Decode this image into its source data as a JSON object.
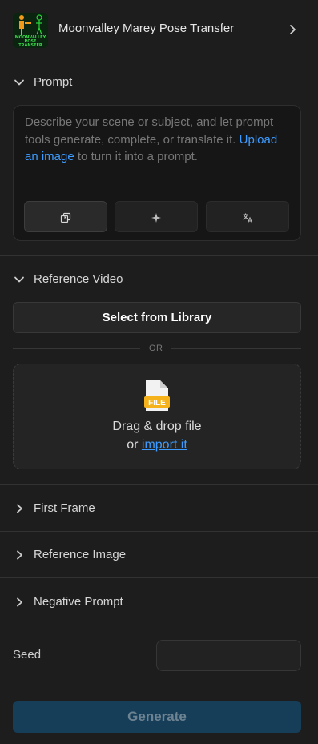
{
  "header": {
    "title": "Moonvalley Marey Pose Transfer",
    "thumb_text": [
      "MOONVALLEY",
      "POSE",
      "TRANSFER"
    ]
  },
  "prompt": {
    "section_label": "Prompt",
    "text_before": "Describe your scene or subject, and let prompt tools generate, complete, or translate it. ",
    "link_text": "Upload an image",
    "text_after": " to turn it into a prompt.",
    "tools": [
      {
        "icon": "copy-icon"
      },
      {
        "icon": "sparkle-icon"
      },
      {
        "icon": "translate-icon"
      }
    ]
  },
  "reference_video": {
    "section_label": "Reference Video",
    "library_button": "Select from Library",
    "or_text": "OR",
    "file_badge": "FILE",
    "drop_text": "Drag & drop file",
    "or_word": "or",
    "import_link": "import it"
  },
  "sections": {
    "first_frame": "First Frame",
    "reference_image": "Reference Image",
    "negative_prompt": "Negative Prompt"
  },
  "seed": {
    "label": "Seed",
    "value": ""
  },
  "generate_button": "Generate",
  "colors": {
    "accent_link": "#3d9bff",
    "generate_bg": "#163e58",
    "file_icon": "#f5b21b"
  }
}
